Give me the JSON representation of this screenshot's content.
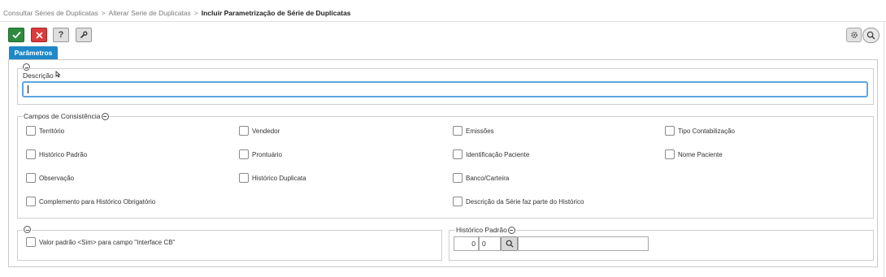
{
  "breadcrumb": {
    "items": [
      "Consultar Séries de Duplicatas",
      "Alterar Serie de Duplicatas"
    ],
    "current": "Incluir Parametrização de Série de Duplicatas",
    "separator": ">"
  },
  "toolbar": {
    "help_label": "?"
  },
  "tabs": [
    {
      "label": "Parâmetros",
      "active": true
    }
  ],
  "descricao": {
    "label": "Descrição",
    "value": ""
  },
  "campos_consistencia": {
    "legend": "Campos de Consistência",
    "items": [
      {
        "label": "Território",
        "checked": false
      },
      {
        "label": "Vendedor",
        "checked": false
      },
      {
        "label": "Emissões",
        "checked": false
      },
      {
        "label": "Tipo Contabilização",
        "checked": false
      },
      {
        "label": "Histórico Padrão",
        "checked": false
      },
      {
        "label": "Prontuário",
        "checked": false
      },
      {
        "label": "Identificação Paciente",
        "checked": false
      },
      {
        "label": "Nome Paciente",
        "checked": false
      },
      {
        "label": "Observação",
        "checked": false
      },
      {
        "label": "Histórico Duplicata",
        "checked": false
      },
      {
        "label": "Banco/Carteira",
        "checked": false
      },
      {
        "label": "Complemento para Histórico Obrigatório",
        "checked": false
      },
      {
        "label": "Descrição da Série faz parte do Histórico",
        "checked": false
      }
    ]
  },
  "interface_cb": {
    "label": "Valor padrão <Sim> para campo \"Interface CB\"",
    "checked": false
  },
  "historico_padrao": {
    "legend": "Histórico Padrão",
    "code1": "0",
    "code2": "0",
    "description": ""
  },
  "colors": {
    "ok_green": "#2e8b3e",
    "cancel_red": "#dc3c3c",
    "tab_blue": "#1e88c8",
    "focus_blue": "#5fa6dd"
  }
}
